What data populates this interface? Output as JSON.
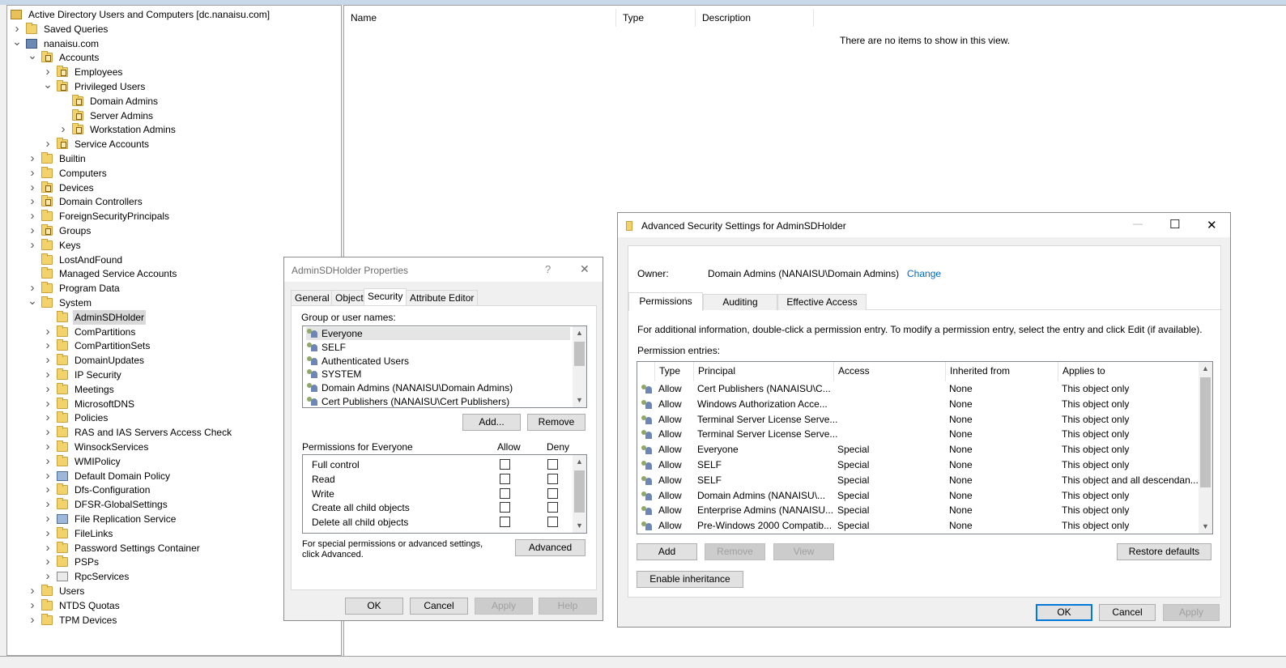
{
  "tree": {
    "items": [
      {
        "label": "Active Directory Users and Computers [dc.nanaisu.com]",
        "depth": 0,
        "expander": "",
        "icon": "root-icon"
      },
      {
        "label": "Saved Queries",
        "depth": 1,
        "expander": ">",
        "icon": "folder-icon"
      },
      {
        "label": "nanaisu.com",
        "depth": 1,
        "expander": "v",
        "icon": "domain-icon"
      },
      {
        "label": "Accounts",
        "depth": 2,
        "expander": "v",
        "icon": "ou-icon"
      },
      {
        "label": "Employees",
        "depth": 3,
        "expander": ">",
        "icon": "ou-icon"
      },
      {
        "label": "Privileged Users",
        "depth": 3,
        "expander": "v",
        "icon": "ou-icon"
      },
      {
        "label": "Domain Admins",
        "depth": 4,
        "expander": "",
        "icon": "ou-icon"
      },
      {
        "label": "Server Admins",
        "depth": 4,
        "expander": "",
        "icon": "ou-icon"
      },
      {
        "label": "Workstation Admins",
        "depth": 4,
        "expander": ">",
        "icon": "ou-icon"
      },
      {
        "label": "Service Accounts",
        "depth": 3,
        "expander": ">",
        "icon": "ou-icon"
      },
      {
        "label": "Builtin",
        "depth": 2,
        "expander": ">",
        "icon": "folder-icon"
      },
      {
        "label": "Computers",
        "depth": 2,
        "expander": ">",
        "icon": "folder-icon"
      },
      {
        "label": "Devices",
        "depth": 2,
        "expander": ">",
        "icon": "ou-icon"
      },
      {
        "label": "Domain Controllers",
        "depth": 2,
        "expander": ">",
        "icon": "ou-icon"
      },
      {
        "label": "ForeignSecurityPrincipals",
        "depth": 2,
        "expander": ">",
        "icon": "folder-icon"
      },
      {
        "label": "Groups",
        "depth": 2,
        "expander": ">",
        "icon": "ou-icon"
      },
      {
        "label": "Keys",
        "depth": 2,
        "expander": ">",
        "icon": "folder-icon"
      },
      {
        "label": "LostAndFound",
        "depth": 2,
        "expander": "",
        "icon": "folder-icon"
      },
      {
        "label": "Managed Service Accounts",
        "depth": 2,
        "expander": "",
        "icon": "folder-icon"
      },
      {
        "label": "Program Data",
        "depth": 2,
        "expander": ">",
        "icon": "folder-icon"
      },
      {
        "label": "System",
        "depth": 2,
        "expander": "v",
        "icon": "folder-icon"
      },
      {
        "label": "AdminSDHolder",
        "depth": 3,
        "expander": "",
        "icon": "folder-icon",
        "selected": true
      },
      {
        "label": "ComPartitions",
        "depth": 3,
        "expander": ">",
        "icon": "folder-icon"
      },
      {
        "label": "ComPartitionSets",
        "depth": 3,
        "expander": ">",
        "icon": "folder-icon"
      },
      {
        "label": "DomainUpdates",
        "depth": 3,
        "expander": ">",
        "icon": "folder-icon"
      },
      {
        "label": "IP Security",
        "depth": 3,
        "expander": ">",
        "icon": "folder-icon"
      },
      {
        "label": "Meetings",
        "depth": 3,
        "expander": ">",
        "icon": "folder-icon"
      },
      {
        "label": "MicrosoftDNS",
        "depth": 3,
        "expander": ">",
        "icon": "folder-icon"
      },
      {
        "label": "Policies",
        "depth": 3,
        "expander": ">",
        "icon": "folder-icon"
      },
      {
        "label": "RAS and IAS Servers Access Check",
        "depth": 3,
        "expander": ">",
        "icon": "folder-icon"
      },
      {
        "label": "WinsockServices",
        "depth": 3,
        "expander": ">",
        "icon": "folder-icon"
      },
      {
        "label": "WMIPolicy",
        "depth": 3,
        "expander": ">",
        "icon": "folder-icon"
      },
      {
        "label": "Default Domain Policy",
        "depth": 3,
        "expander": ">",
        "icon": "gpo-icon"
      },
      {
        "label": "Dfs-Configuration",
        "depth": 3,
        "expander": ">",
        "icon": "folder-icon"
      },
      {
        "label": "DFSR-GlobalSettings",
        "depth": 3,
        "expander": ">",
        "icon": "folder-icon"
      },
      {
        "label": "File Replication Service",
        "depth": 3,
        "expander": ">",
        "icon": "gpo-icon"
      },
      {
        "label": "FileLinks",
        "depth": 3,
        "expander": ">",
        "icon": "folder-icon"
      },
      {
        "label": "Password Settings Container",
        "depth": 3,
        "expander": ">",
        "icon": "folder-icon"
      },
      {
        "label": "PSPs",
        "depth": 3,
        "expander": ">",
        "icon": "folder-icon"
      },
      {
        "label": "RpcServices",
        "depth": 3,
        "expander": ">",
        "icon": "rpc-icon"
      },
      {
        "label": "Users",
        "depth": 2,
        "expander": ">",
        "icon": "folder-icon"
      },
      {
        "label": "NTDS Quotas",
        "depth": 2,
        "expander": ">",
        "icon": "folder-icon"
      },
      {
        "label": "TPM Devices",
        "depth": 2,
        "expander": ">",
        "icon": "folder-icon"
      }
    ]
  },
  "list": {
    "columns": [
      "Name",
      "Type",
      "Description"
    ],
    "empty_message": "There are no items to show in this view."
  },
  "props": {
    "title": "AdminSDHolder Properties",
    "help_glyph": "?",
    "close_glyph": "✕",
    "tabs": [
      "General",
      "Object",
      "Security",
      "Attribute Editor"
    ],
    "active_tab": "Security",
    "group_label": "Group or user names:",
    "principals": [
      "Everyone",
      "SELF",
      "Authenticated Users",
      "SYSTEM",
      "Domain Admins (NANAISU\\Domain Admins)",
      "Cert Publishers (NANAISU\\Cert Publishers)"
    ],
    "add_label": "Add...",
    "remove_label": "Remove",
    "perms_label": "Permissions for Everyone",
    "allow_label": "Allow",
    "deny_label": "Deny",
    "permissions": [
      "Full control",
      "Read",
      "Write",
      "Create all child objects",
      "Delete all child objects"
    ],
    "advanced_text": "For special permissions or advanced settings, click Advanced.",
    "advanced_label": "Advanced",
    "ok_label": "OK",
    "cancel_label": "Cancel",
    "apply_label": "Apply",
    "help_label": "Help"
  },
  "adv": {
    "title": "Advanced Security Settings for AdminSDHolder",
    "minimize_glyph": "—",
    "maximize_glyph": "☐",
    "close_glyph": "✕",
    "owner_label": "Owner:",
    "owner_value": "Domain Admins (NANAISU\\Domain Admins)",
    "change_label": "Change",
    "tabs": [
      "Permissions",
      "Auditing",
      "Effective Access"
    ],
    "active_tab": "Permissions",
    "info_text": "For additional information, double-click a permission entry. To modify a permission entry, select the entry and click Edit (if available).",
    "entries_label": "Permission entries:",
    "columns": [
      "Type",
      "Principal",
      "Access",
      "Inherited from",
      "Applies to"
    ],
    "rows": [
      {
        "type": "Allow",
        "principal": "Cert Publishers (NANAISU\\C...",
        "access": "",
        "inherited": "None",
        "applies": "This object only"
      },
      {
        "type": "Allow",
        "principal": "Windows Authorization Acce...",
        "access": "",
        "inherited": "None",
        "applies": "This object only"
      },
      {
        "type": "Allow",
        "principal": "Terminal Server License Serve...",
        "access": "",
        "inherited": "None",
        "applies": "This object only"
      },
      {
        "type": "Allow",
        "principal": "Terminal Server License Serve...",
        "access": "",
        "inherited": "None",
        "applies": "This object only"
      },
      {
        "type": "Allow",
        "principal": "Everyone",
        "access": "Special",
        "inherited": "None",
        "applies": "This object only"
      },
      {
        "type": "Allow",
        "principal": "SELF",
        "access": "Special",
        "inherited": "None",
        "applies": "This object only"
      },
      {
        "type": "Allow",
        "principal": "SELF",
        "access": "Special",
        "inherited": "None",
        "applies": "This object and all descendan..."
      },
      {
        "type": "Allow",
        "principal": "Domain Admins (NANAISU\\...",
        "access": "Special",
        "inherited": "None",
        "applies": "This object only"
      },
      {
        "type": "Allow",
        "principal": "Enterprise Admins (NANAISU...",
        "access": "Special",
        "inherited": "None",
        "applies": "This object only"
      },
      {
        "type": "Allow",
        "principal": "Pre-Windows 2000 Compatib...",
        "access": "Special",
        "inherited": "None",
        "applies": "This object only"
      }
    ],
    "add_label": "Add",
    "remove_label": "Remove",
    "view_label": "View",
    "restore_label": "Restore defaults",
    "enable_inheritance_label": "Enable inheritance",
    "ok_label": "OK",
    "cancel_label": "Cancel",
    "apply_label": "Apply"
  },
  "colors": {
    "accent": "#0078d7",
    "link": "#0066cc",
    "selection": "#d9d9d9"
  }
}
